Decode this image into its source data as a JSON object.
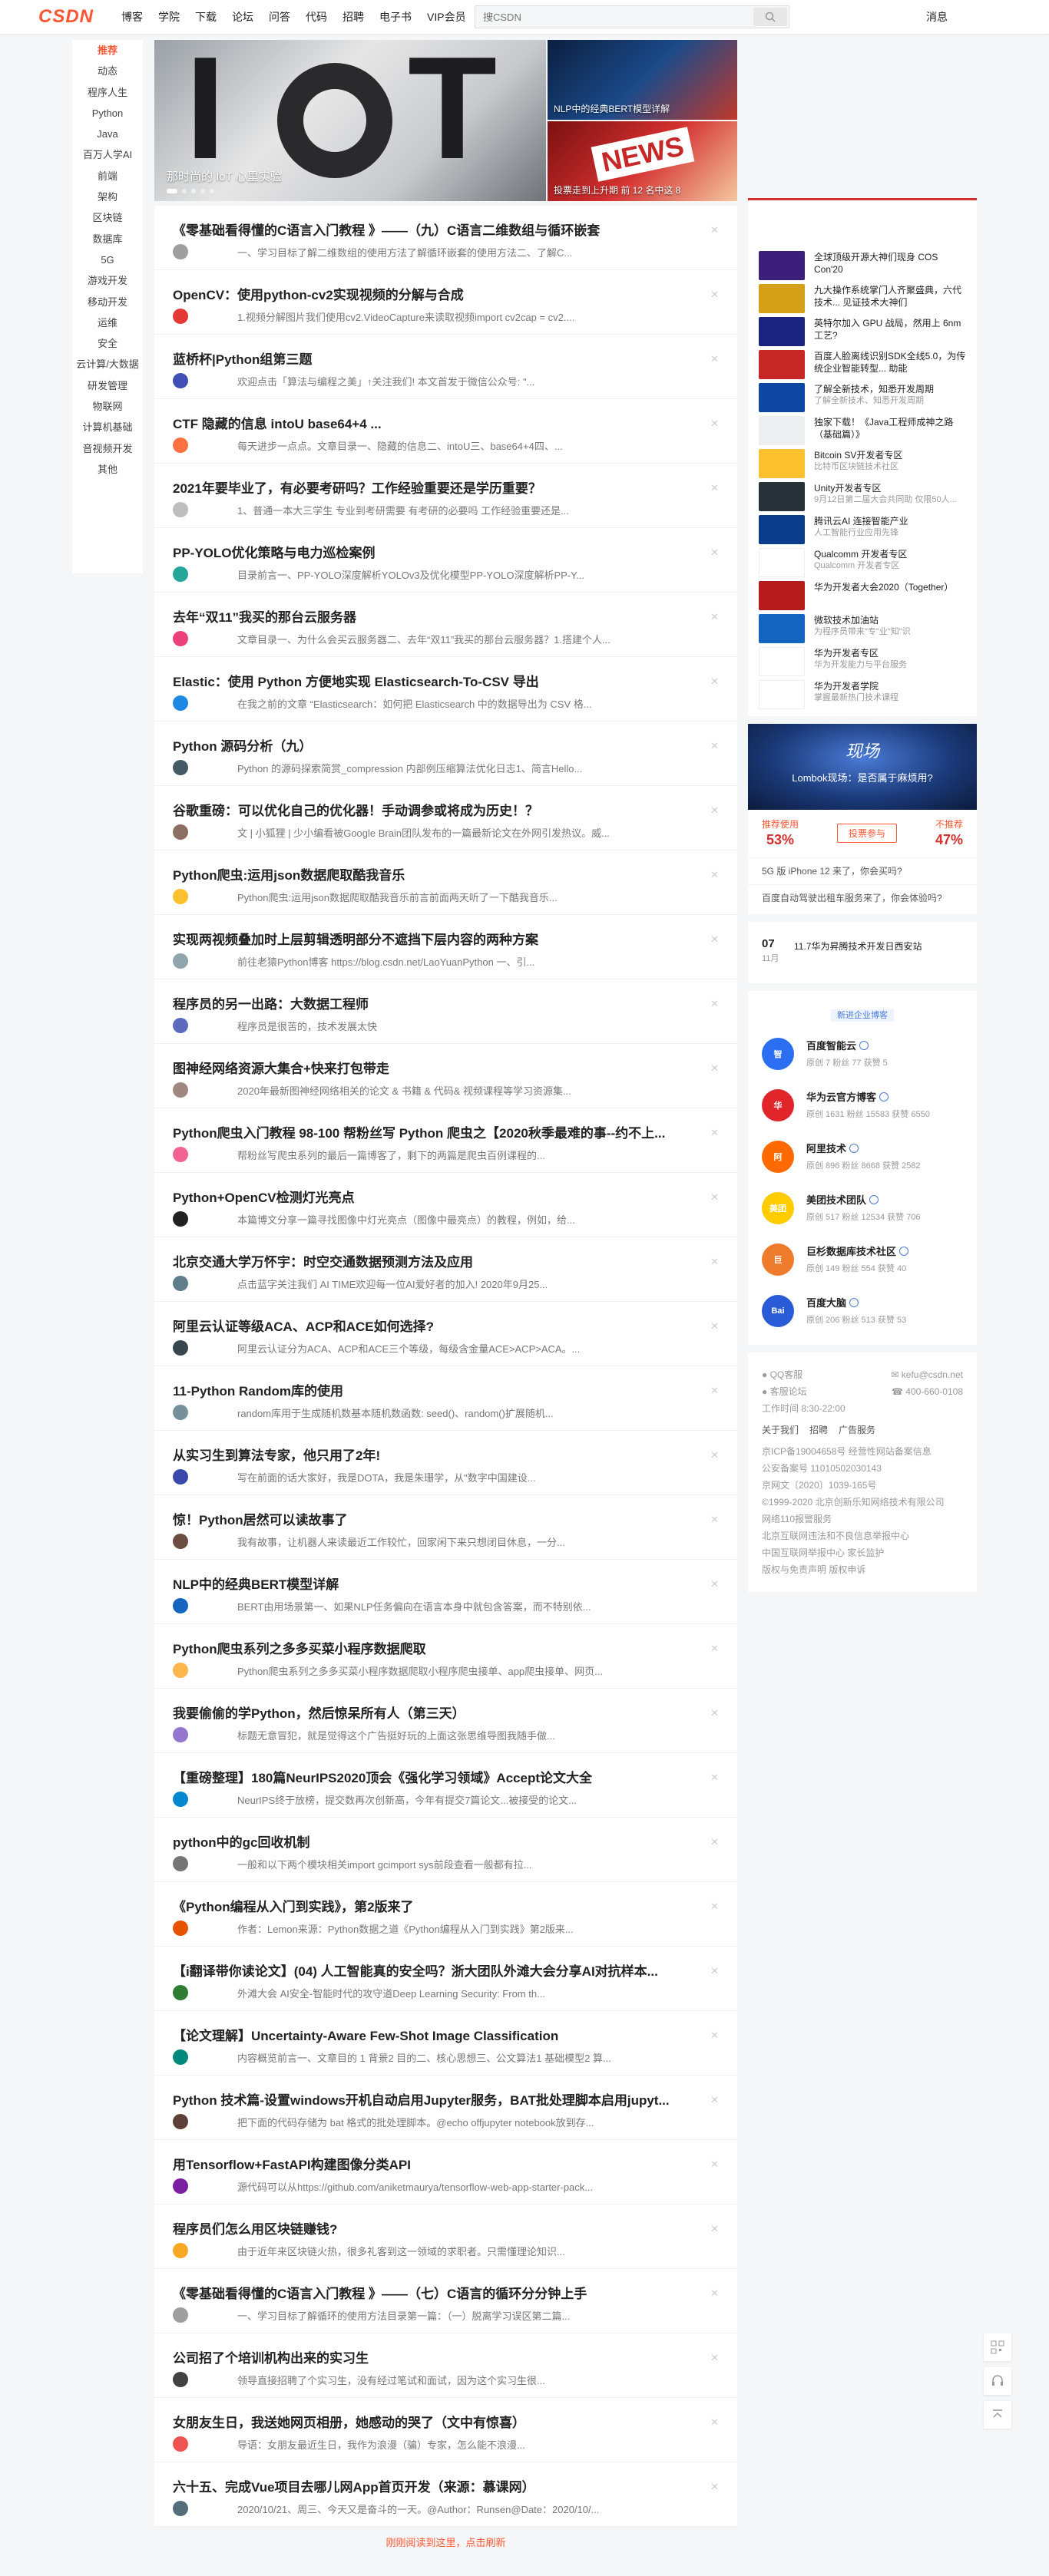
{
  "header": {
    "logo": "CSDN",
    "nav": [
      "博客",
      "学院",
      "下载",
      "论坛",
      "问答",
      "代码",
      "招聘",
      "电子书",
      "VIP会员"
    ],
    "search_placeholder": "搜CSDN",
    "message": "消息"
  },
  "sidebar": {
    "items": [
      "推荐",
      "动态",
      "程序人生",
      "Python",
      "Java",
      "百万人学AI",
      "前端",
      "架构",
      "区块链",
      "数据库",
      "5G",
      "游戏开发",
      "移动开发",
      "运维",
      "安全",
      "云计算/大数据",
      "研发管理",
      "物联网",
      "计算机基础",
      "音视频开发",
      "其他"
    ]
  },
  "carousel": {
    "caption": "那时尚的 IoT 心里实验",
    "side1_caption": "NLP中的经典BERT模型详解",
    "side2_caption": "投票走到上升期 前 12 名中这 8"
  },
  "feed": [
    {
      "title": "《零基础看得懂的C语言入门教程 》——（九）C语言二维数组与循环嵌套",
      "desc": "一、学习目标了解二维数组的使用方法了解循环嵌套的使用方法二、了解C..."
    },
    {
      "title": "OpenCV：使用python-cv2实现视频的分解与合成",
      "desc": "1.视频分解图片我们使用cv2.VideoCapture来读取视频import cv2cap = cv2...."
    },
    {
      "title": "蓝桥杯|Python组第三题",
      "desc": "欢迎点击「算法与编程之美」↑关注我们! 本文首发于微信公众号: \"..."
    },
    {
      "title": "CTF 隐藏的信息 intoU base64+4 ...",
      "desc": "每天进步一点点。文章目录一、隐藏的信息二、intoU三、base64+4四、..."
    },
    {
      "title": "2021年要毕业了，有必要考研吗？工作经验重要还是学历重要？",
      "desc": "1、普通一本大三学生 专业到考研需要 有考研的必要吗 工作经验重要还是..."
    },
    {
      "title": "PP-YOLO优化策略与电力巡检案例",
      "desc": "目录前言一、PP-YOLO深度解析YOLOv3及优化模型PP-YOLO深度解析PP-Y..."
    },
    {
      "title": "去年“双11”我买的那台云服务器",
      "desc": "文章目录一、为什么会买云服务器二、去年“双11”我买的那台云服务器？1.搭建个人..."
    },
    {
      "title": "Elastic：使用 Python 方便地实现 Elasticsearch-To-CSV 导出",
      "desc": "在我之前的文章 “Elasticsearch：如何把 Elasticsearch 中的数据导出为 CSV 格..."
    },
    {
      "title": "Python 源码分析（九）",
      "desc": "Python 的源码探索简赏_compression 内部例压缩算法优化日志1、简言Hello..."
    },
    {
      "title": "谷歌重磅：可以优化自己的优化器！手动调参或将成为历史！？",
      "desc": "文 | 小狐狸 | 少小编看被Google Brain团队发布的一篇最新论文在外网引发热议。威..."
    },
    {
      "title": "Python爬虫:运用json数据爬取酷我音乐",
      "desc": "Python爬虫:运用json数据爬取酷我音乐前言前面两天听了一下酷我音乐..."
    },
    {
      "title": "实现两视频叠加时上层剪辑透明部分不遮挡下层内容的两种方案",
      "desc": "前往老猿Python博客 https://blog.csdn.net/LaoYuanPython 一、引..."
    },
    {
      "title": "程序员的另一出路：大数据工程师",
      "desc": "程序员是很苦的，技术发展太快"
    },
    {
      "title": "图神经网络资源大集合+快来打包带走",
      "desc": "2020年最新图神经网络相关的论文 & 书籍 & 代码& 视频课程等学习资源集..."
    },
    {
      "title": "Python爬虫入门教程 98-100 帮粉丝写 Python 爬虫之【2020秋季最难的事--约不上...",
      "desc": "帮粉丝写爬虫系列的最后一篇博客了，剩下的两篇是爬虫百例课程的..."
    },
    {
      "title": "Python+OpenCV检测灯光亮点",
      "desc": "本篇博文分享一篇寻找图像中灯光亮点（图像中最亮点）的教程，例如，给..."
    },
    {
      "title": "北京交通大学万怀宇：时空交通数据预测方法及应用",
      "desc": "点击蓝字关注我们 AI TIME欢迎每一位AI爱好者的加入! 2020年9月25..."
    },
    {
      "title": "阿里云认证等级ACA、ACP和ACE如何选择?",
      "desc": "阿里云认证分为ACA、ACP和ACE三个等级，每级含金量ACE>ACP>ACA。..."
    },
    {
      "title": "11-Python Random库的使用",
      "desc": "random库用于生成随机数基本随机数函数: seed()、random()扩展随机..."
    },
    {
      "title": "从实习生到算法专家，他只用了2年!",
      "desc": "写在前面的话大家好，我是DOTA，我是朱珊学，从\"数字中国建设..."
    },
    {
      "title": "惊！Python居然可以读故事了",
      "desc": "我有故事，让机器人来读最近工作较忙，回家闲下来只想闭目休息，一分..."
    },
    {
      "title": "NLP中的经典BERT模型详解",
      "desc": "BERT由用场景第一、如果NLP任务偏向在语言本身中就包含答案，而不特别依..."
    },
    {
      "title": "Python爬虫系列之多多买菜小程序数据爬取",
      "desc": "Python爬虫系列之多多买菜小程序数据爬取小程序爬虫接单、app爬虫接单、网页..."
    },
    {
      "title": "我要偷偷的学Python，然后惊呆所有人（第三天）",
      "desc": "标题无意冒犯，就是觉得这个广告挺好玩的上面这张思维导图我随手做..."
    },
    {
      "title": "【重磅整理】180篇NeurIPS2020顶会《强化学习领域》Accept论文大全",
      "desc": "NeurIPS终于放榜，提交数再次创新高，今年有提交7篇论文...被接受的论文..."
    },
    {
      "title": "python中的gc回收机制",
      "desc": "一般和以下两个模块相关import gcimport sys前段查看一般都有拉..."
    },
    {
      "title": "《Python编程从入门到实践》，第2版来了",
      "desc": "作者：Lemon来源：Python数据之道《Python编程从入门到实践》第2版来..."
    },
    {
      "title": "【i翻译带你读论文】(04) 人工智能真的安全吗？浙大团队外滩大会分享AI对抗样本...",
      "desc": "外滩大会 AI安全-智能时代的攻守道Deep Learning Security: From th..."
    },
    {
      "title": "【论文理解】Uncertainty-Aware Few-Shot Image Classification",
      "desc": "内容概览前言一、文章目的 1 背景2 目的二、核心思想三、公文算法1 基础模型2 算..."
    },
    {
      "title": "Python 技术篇-设置windows开机自动启用Jupyter服务，BAT批处理脚本启用jupyt...",
      "desc": "把下面的代码存储为 bat 格式的批处理脚本。@echo offjupyter notebook放到存..."
    },
    {
      "title": "用Tensorflow+FastAPI构建图像分类API",
      "desc": "源代码可以从https://github.com/aniketmaurya/tensorflow-web-app-starter-pack..."
    },
    {
      "title": "程序员们怎么用区块链赚钱?",
      "desc": "由于近年来区块链火热，很多礼客到这一领域的求职者。只需懂理论知识..."
    },
    {
      "title": "《零基础看得懂的C语言入门教程 》——（七）C语言的循环分分钟上手",
      "desc": "一、学习目标了解循环的使用方法目录第一篇：（一）脱离学习误区第二篇..."
    },
    {
      "title": "公司招了个培训机构出来的实习生",
      "desc": "领导直接招聘了个实习生，没有经过笔试和面试，因为这个实习生很..."
    },
    {
      "title": "女朋友生日，我送她网页相册，她感动的哭了（文中有惊喜）",
      "desc": "导语：女朋友最近生日，我作为浪漫（骗）专家，怎么能不浪漫..."
    },
    {
      "title": "六十五、完成Vue项目去哪儿网App首页开发（来源：慕课网）",
      "desc": "2020/10/21、周三、今天又是奋斗的一天。@Author：Runsen@Date：2020/10/..."
    }
  ],
  "feed_footer": "刚刚阅读到这里，点击刷新",
  "ads": [
    {
      "title": "全球顶级开源大神们现身 COS Con'20",
      "sub": ""
    },
    {
      "title": "九大操作系统掌门人齐聚盛典，六代技术... 见证技术大神们",
      "sub": ""
    },
    {
      "title": "英特尔加入 GPU 战局，然用上 6nm 工艺?",
      "sub": ""
    },
    {
      "title": "百度人脸离线识别SDK全线5.0，为传统企业智能转型... 助能",
      "sub": ""
    },
    {
      "title": "了解全新技术，知悉开发周期",
      "sub": "了解全新技术、知悉开发周期"
    },
    {
      "title": "独家下载！《Java工程师成神之路（基础篇）》",
      "sub": ""
    },
    {
      "title": "Bitcoin SV开发者专区",
      "sub": "比特币区块链技术社区"
    },
    {
      "title": "Unity开发者专区",
      "sub": "9月12日第二届大会共同助 仅限50人..."
    },
    {
      "title": "腾讯云AI 连接智能产业",
      "sub": "人工智能行业应用先锋"
    },
    {
      "title": "Qualcomm 开发者专区",
      "sub": "Qualcomm 开发者专区"
    },
    {
      "title": "华为开发者大会2020（Together）",
      "sub": ""
    },
    {
      "title": "微软技术加油站",
      "sub": "为程序员带来\"专\"业\"知\"识"
    },
    {
      "title": "华为开发者专区",
      "sub": "华为开发能力与平台服务"
    },
    {
      "title": "华为开发者学院",
      "sub": "掌握最新热门技术课程"
    }
  ],
  "vote": {
    "logo": "现场",
    "banner": "Lombok现场：是否属于麻烦用?",
    "left_label": "推荐使用",
    "left_pct": "53%",
    "button": "投票参与",
    "right_label": "不推荐",
    "right_pct": "47%",
    "q1": "5G 版 iPhone 12 来了，你会买吗?",
    "q2": "百度自动驾驶出租车服务来了，你会体验吗?"
  },
  "live": {
    "day": "07",
    "month": "11月",
    "title": "11.7华为昇腾技术开发日西安站"
  },
  "blogs_head": "新进企业博客",
  "blogs": [
    {
      "name": "百度智能云",
      "stats": "原创 7  粉丝 77  获赞 5",
      "color": "#2b6ef2",
      "short": "智"
    },
    {
      "name": "华为云官方博客",
      "stats": "原创 1631  粉丝 15583  获赞 6550",
      "color": "#e0262a",
      "short": "华"
    },
    {
      "name": "阿里技术",
      "stats": "原创 896  粉丝 8668  获赞 2582",
      "color": "#ff6a00",
      "short": "阿"
    },
    {
      "name": "美团技术团队",
      "stats": "原创 517  粉丝 12534  获赞 706",
      "color": "#ffcc00",
      "short": "美团"
    },
    {
      "name": "巨杉数据库技术社区",
      "stats": "原创 149  粉丝 554  获赞 40",
      "color": "#ef7b2c",
      "short": "巨"
    },
    {
      "name": "百度大脑",
      "stats": "原创 206  粉丝 513  获赞 53",
      "color": "#2a5bd7",
      "short": "Bai"
    }
  ],
  "footer": {
    "qq": "QQ客服",
    "email": "kefu@csdn.net",
    "kefu": "客服论坛",
    "phone": "400-660-0108",
    "hours": "工作时间 8:30-22:00",
    "links": [
      "关于我们",
      "招聘",
      "广告服务"
    ],
    "lines": [
      "京ICP备19004658号  经营性网站备案信息",
      "公安备案号 11010502030143",
      "京网文〔2020〕1039-165号",
      "©1999-2020 北京创新乐知网络技术有限公司",
      "网络110报警服务",
      "北京互联网违法和不良信息举报中心",
      "中国互联网举报中心  家长监护",
      "版权与免责声明  版权申诉"
    ]
  }
}
